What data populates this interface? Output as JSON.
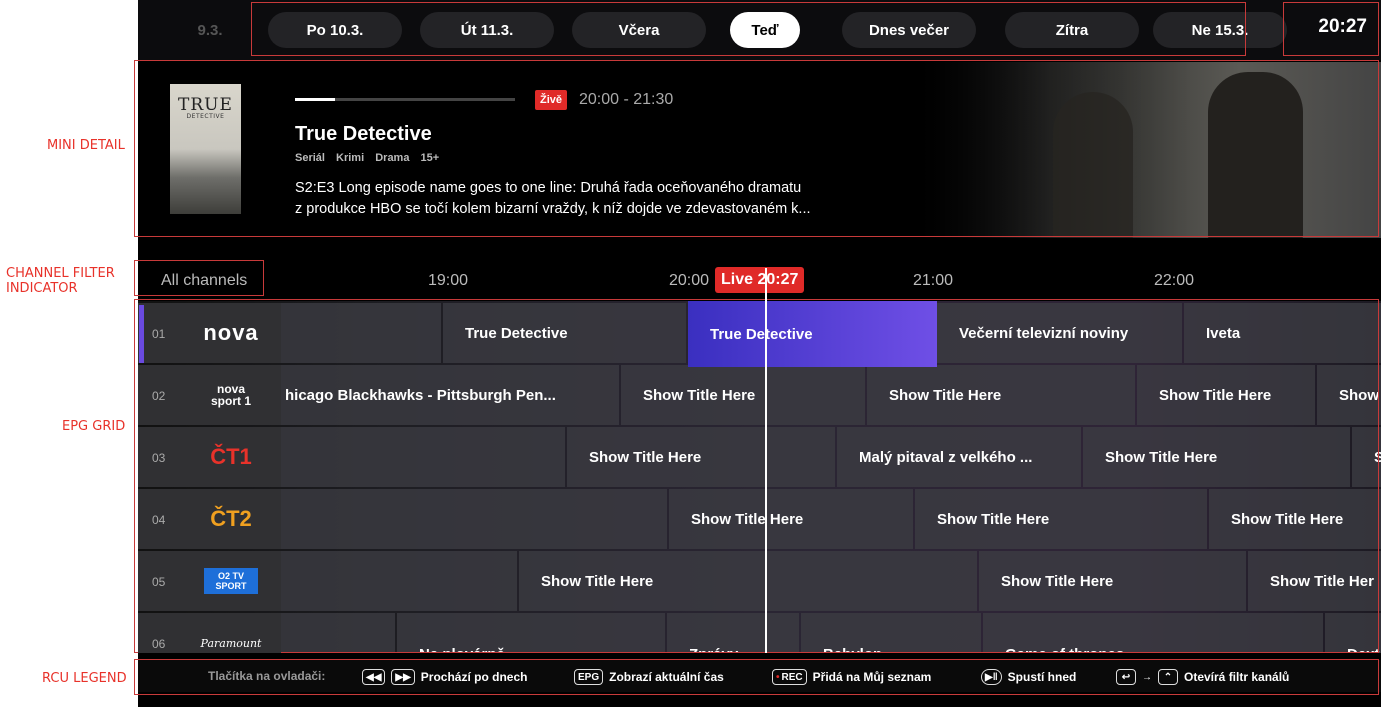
{
  "annotations": {
    "mini_detail": "MINI DETAIL",
    "channel_filter": "CHANNEL FILTER\nINDICATOR",
    "epg_grid": "EPG GRID",
    "rcu_legend": "RCU LEGEND"
  },
  "daybar": {
    "days": [
      {
        "label": "9.3.",
        "state": "faded"
      },
      {
        "label": "Po 10.3.",
        "state": "normal"
      },
      {
        "label": "Út 11.3.",
        "state": "normal"
      },
      {
        "label": "Včera",
        "state": "normal"
      },
      {
        "label": "Teď",
        "state": "active"
      },
      {
        "label": "Dnes večer",
        "state": "normal"
      },
      {
        "label": "Zítra",
        "state": "normal"
      },
      {
        "label": "Ne 15.3.",
        "state": "normal"
      }
    ],
    "clock": "20:27"
  },
  "detail": {
    "poster_title": "TRUE",
    "poster_subtitle": "DETECTIVE",
    "live_badge": "Živě",
    "time_range": "20:00 - 21:30",
    "progress": 0.18,
    "title": "True Detective",
    "tags": [
      "Seriál",
      "Krimi",
      "Drama",
      "15+"
    ],
    "description_line1": "S2:E3 Long episode name goes to one line: Druhá řada oceňovaného dramatu",
    "description_line2": "z produkce HBO se točí kolem bizarní vraždy, k níž dojde ve zdevastovaném k..."
  },
  "timeline": {
    "filter": "All channels",
    "ticks": [
      "19:00",
      "20:00",
      "21:00",
      "22:00"
    ],
    "live_marker": "Live 20:27"
  },
  "channels": [
    {
      "num": "01",
      "logo": "nova",
      "programs": [
        "",
        "True Detective",
        "True Detective",
        "Večerní televizní noviny",
        "Iveta"
      ]
    },
    {
      "num": "02",
      "logo": "nova sport 1",
      "programs": [
        "hicago Blackhawks - Pittsburgh Pen...",
        "Show Title Here",
        "Show Title Here",
        "Show Title Here",
        "Show"
      ]
    },
    {
      "num": "03",
      "logo": "ČT1",
      "programs": [
        "",
        "Show Title Here",
        "Malý pitaval z velkého ...",
        "Show Title Here",
        "S"
      ]
    },
    {
      "num": "04",
      "logo": "ČT2",
      "programs": [
        "",
        "Show Title Here",
        "Show Title Here",
        "Show Title Here"
      ]
    },
    {
      "num": "05",
      "logo": "O2 TV SPORT",
      "programs": [
        "",
        "Show Title Here",
        "Show Title Here",
        "Show Title Her"
      ]
    },
    {
      "num": "06",
      "logo": "Paramount",
      "programs": [
        "",
        "Na plovárně",
        "Zprávy",
        "Babylon",
        "Game of thrones",
        "Dext"
      ]
    }
  ],
  "legend": {
    "intro": "Tlačítka na ovladači:",
    "days": "Prochází po dnech",
    "epg_key": "EPG",
    "epg": "Zobrazí aktuální čas",
    "rec_key": "REC",
    "rec": "Přidá na Můj seznam",
    "play": "Spustí hned",
    "filter": "Otevírá filtr kanálů"
  },
  "colors": {
    "accent": "#6a4ae0",
    "live": "#e02a28",
    "annotation": "#e8322a"
  }
}
